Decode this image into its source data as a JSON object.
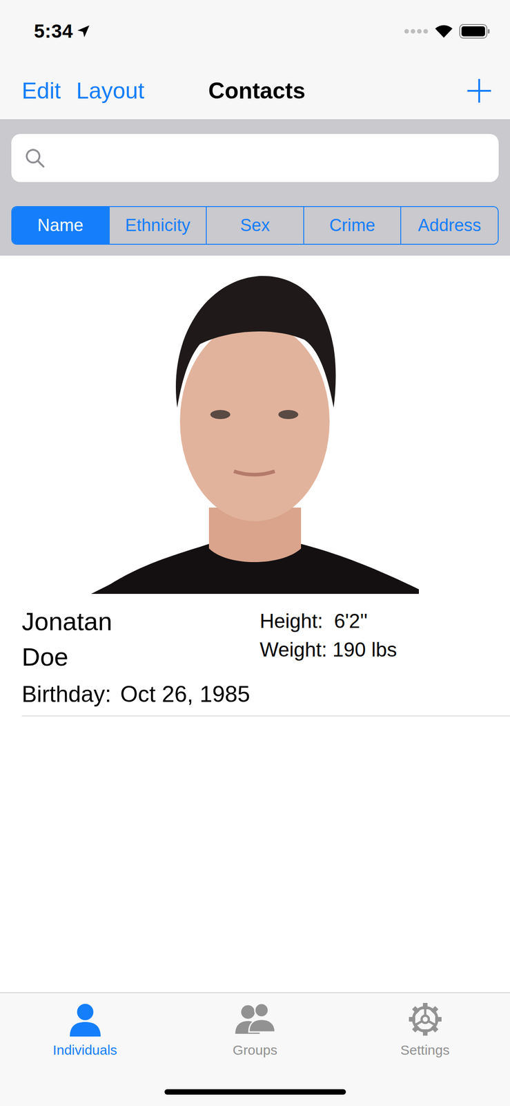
{
  "status_bar": {
    "time": "5:34"
  },
  "nav_bar": {
    "buttons": [
      "Edit",
      "Layout"
    ],
    "title": "Contacts"
  },
  "search": {
    "placeholder": ""
  },
  "segments": [
    {
      "label": "Name",
      "selected": true
    },
    {
      "label": "Ethnicity",
      "selected": false
    },
    {
      "label": "Sex",
      "selected": false
    },
    {
      "label": "Crime",
      "selected": false
    },
    {
      "label": "Address",
      "selected": false
    }
  ],
  "contact": {
    "first_name": "Jonatan",
    "last_name": "Doe",
    "height_label": "Height:",
    "height": "6'2''",
    "weight_label": "Weight:",
    "weight": "190 lbs",
    "birthday_label": "Birthday:",
    "birthday": "Oct 26, 1985"
  },
  "tab_bar": [
    {
      "label": "Individuals",
      "selected": true
    },
    {
      "label": "Groups",
      "selected": false
    },
    {
      "label": "Settings",
      "selected": false
    }
  ]
}
